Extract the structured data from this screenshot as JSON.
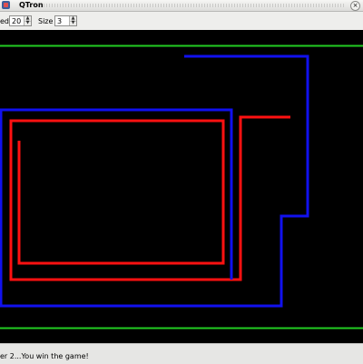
{
  "window": {
    "title": "QTron",
    "close_symbol": "×"
  },
  "toolbar": {
    "speed_label": "ed",
    "speed_value": "20",
    "size_label": "Size",
    "size_value": "3",
    "spin_up": "▲",
    "spin_down": "▼"
  },
  "status": {
    "message": "er 2...You win the game!"
  },
  "colors": {
    "background": "#000000",
    "border": "#22cc22",
    "player_red": "#ff1111",
    "player_blue": "#1111ee"
  },
  "game": {
    "border_lines": [
      "top-boundary",
      "bottom-boundary"
    ],
    "trails": [
      {
        "name": "blue-trail-outer",
        "color": "blue"
      },
      {
        "name": "red-trail-right",
        "color": "red"
      },
      {
        "name": "blue-trail-inner",
        "color": "blue"
      },
      {
        "name": "red-trail-outer",
        "color": "red"
      },
      {
        "name": "red-trail-inner",
        "color": "red"
      }
    ]
  }
}
